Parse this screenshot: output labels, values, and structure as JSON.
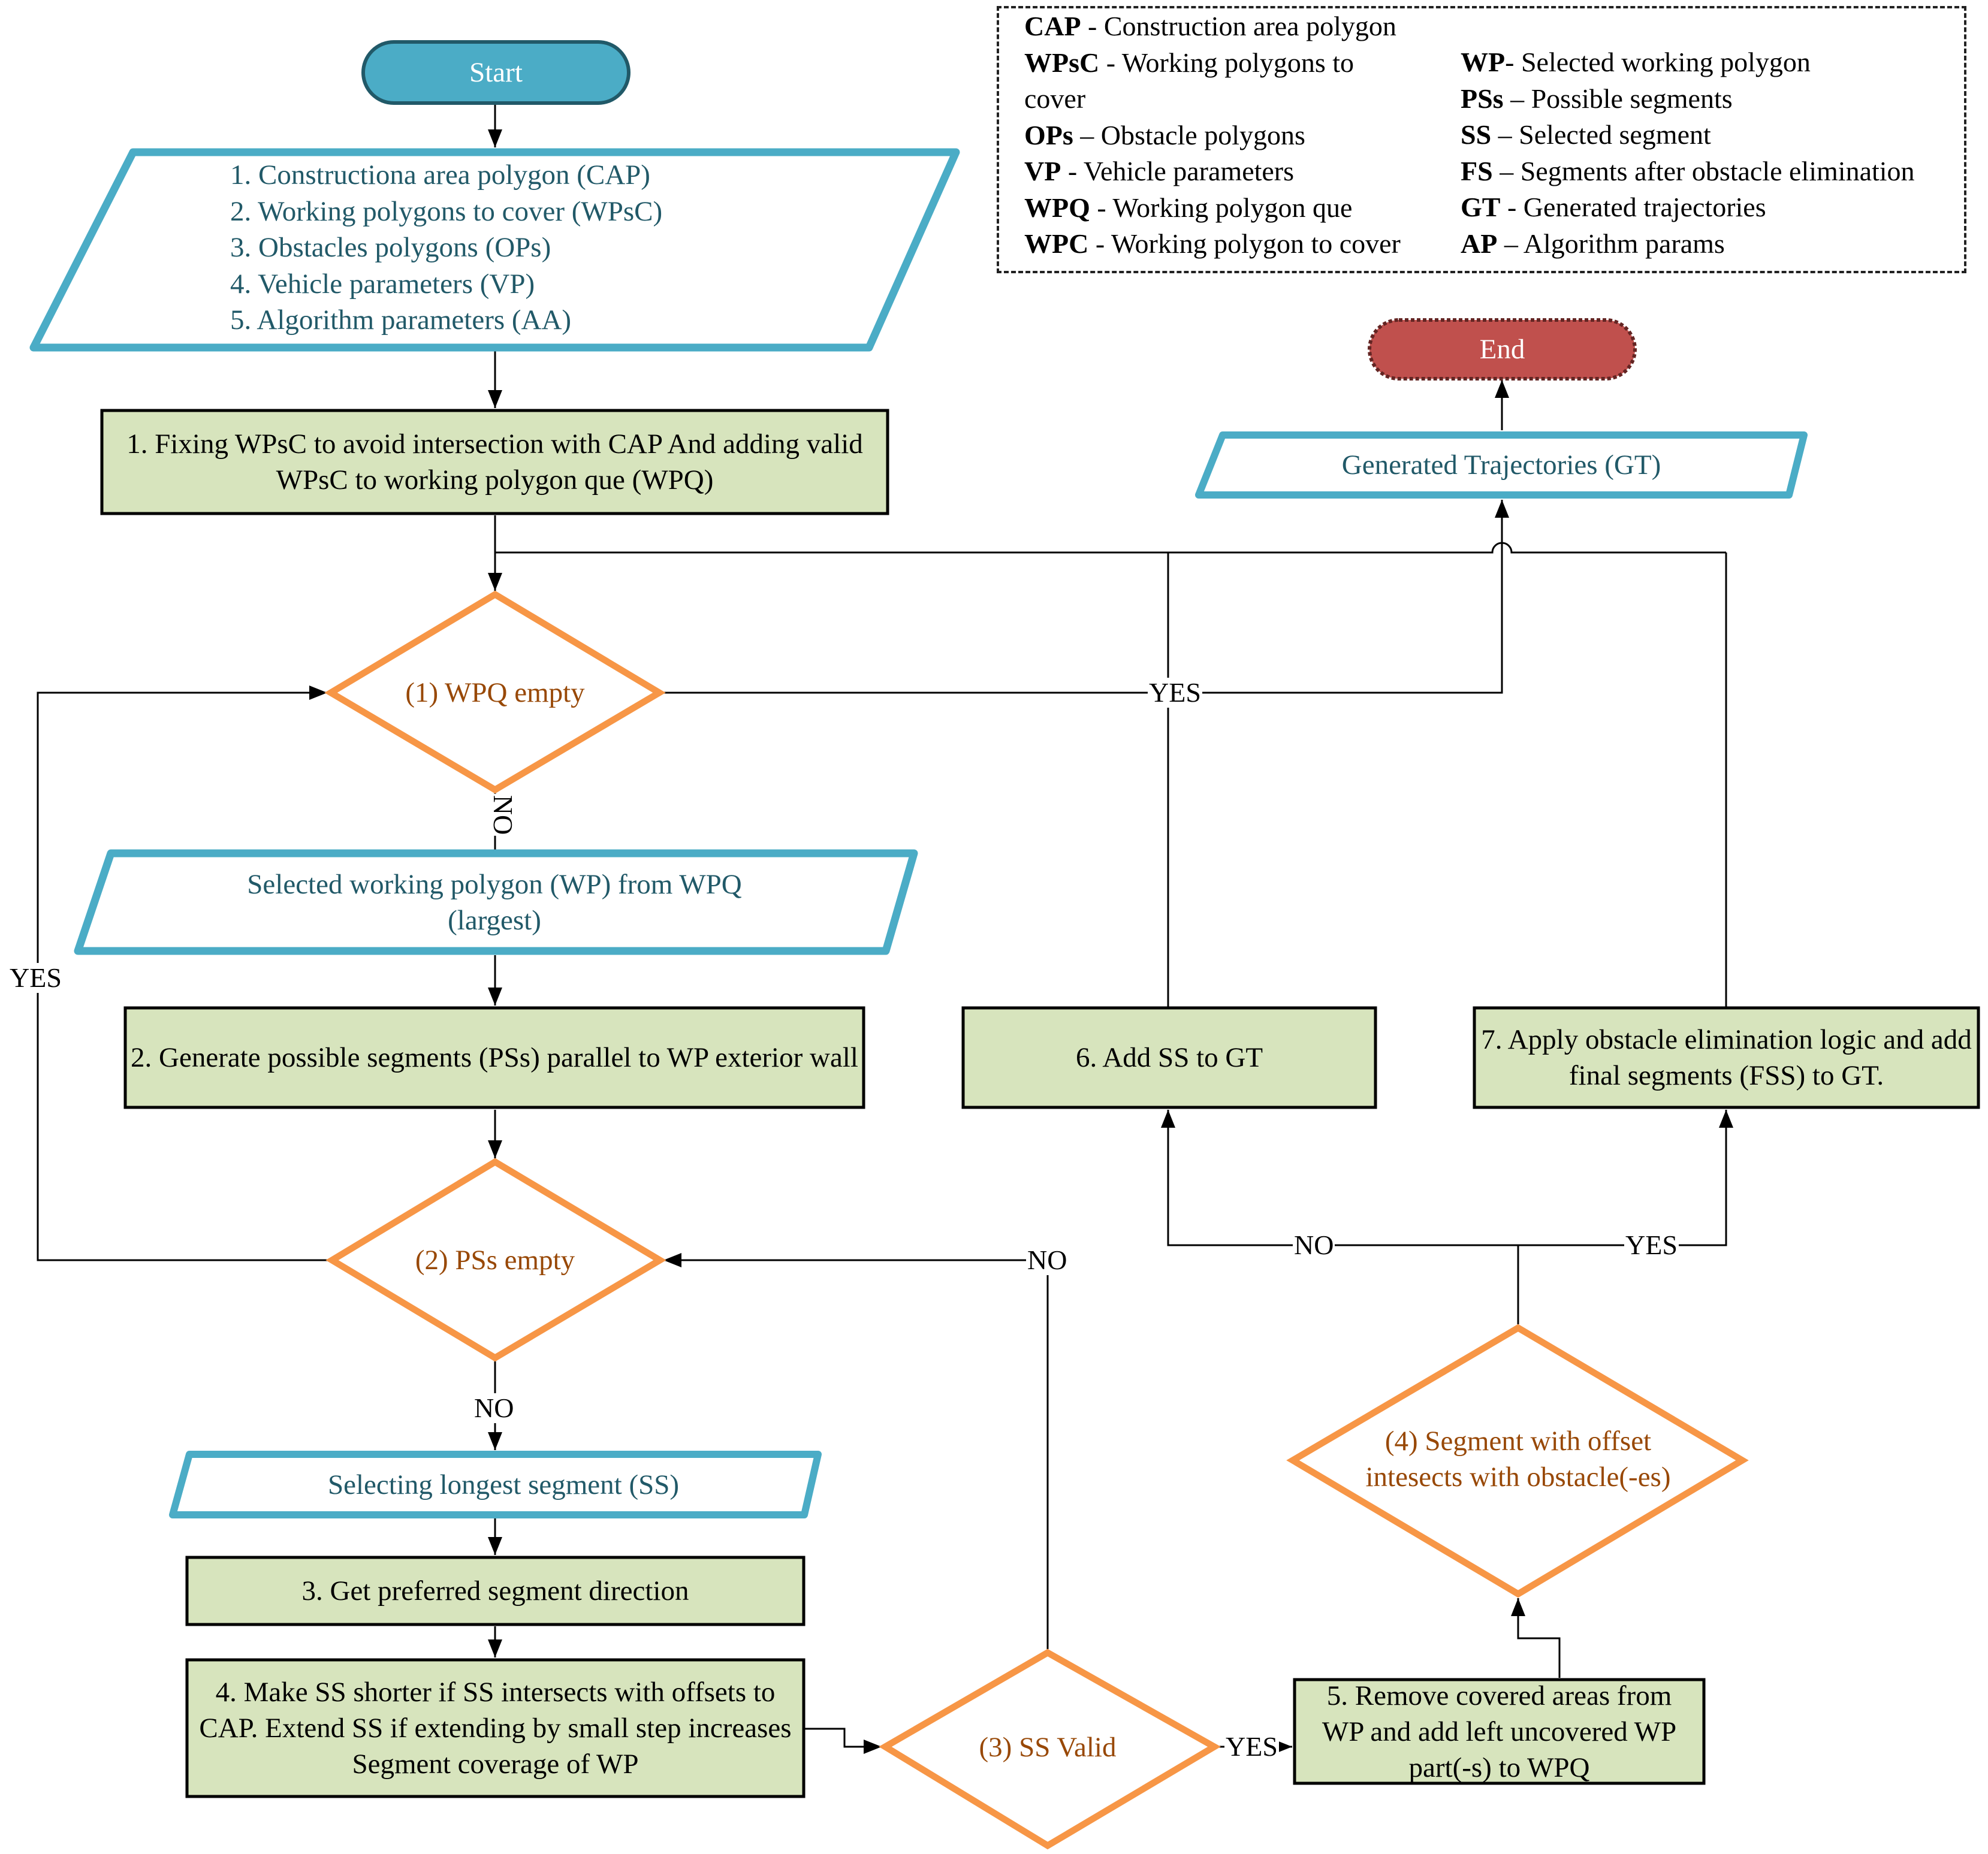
{
  "colors": {
    "start_fill": "#4bacc6",
    "start_stroke": "#215968",
    "end_fill": "#c0504d",
    "end_stroke": "#632523",
    "io_stroke": "#4bacc6",
    "io_text": "#215968",
    "process_fill": "#d7e4bd",
    "process_stroke": "#000000",
    "decision_stroke": "#f79646",
    "decision_text": "#984806"
  },
  "legend": {
    "left": [
      {
        "abbr": "CAP",
        "sep": " - ",
        "desc": "Construction area polygon"
      },
      {
        "abbr": "WPsC",
        "sep": " - ",
        "desc": "Working polygons to cover"
      },
      {
        "abbr": "OPs",
        "sep": " – ",
        "desc": "Obstacle polygons"
      },
      {
        "abbr": "VP",
        "sep": " - ",
        "desc": "Vehicle parameters"
      },
      {
        "abbr": "WPQ",
        "sep": " - ",
        "desc": "Working polygon que"
      },
      {
        "abbr": "WPC",
        "sep": " - ",
        "desc": "Working polygon to cover"
      }
    ],
    "right": [
      {
        "abbr": "WP",
        "sep": "- ",
        "desc": "Selected working polygon"
      },
      {
        "abbr": "PSs",
        "sep": " – ",
        "desc": "Possible segments"
      },
      {
        "abbr": "SS",
        "sep": " – ",
        "desc": "Selected segment"
      },
      {
        "abbr": "FS",
        "sep": " – ",
        "desc": "Segments after obstacle elimination"
      },
      {
        "abbr": "GT",
        "sep": " - ",
        "desc": "Generated trajectories"
      },
      {
        "abbr": "AP",
        "sep": " – ",
        "desc": "Algorithm params"
      }
    ]
  },
  "nodes": {
    "start": "Start",
    "end": "End",
    "inputs": [
      "1. Constructiona area polygon (CAP)",
      "2. Working polygons to cover (WPsC)",
      "3. Obstacles polygons (OPs)",
      "4. Vehicle parameters (VP)",
      "5. Algorithm parameters (AA)"
    ],
    "step1": "1. Fixing WPsC  to avoid intersection with CAP And adding valid WPsC to working polygon que (WPQ)",
    "decision1": "(1) WPQ empty",
    "select_wp": "Selected working polygon (WP) from WPQ (largest)",
    "step2": "2. Generate possible segments (PSs) parallel to WP exterior wall",
    "decision2": "(2) PSs empty",
    "select_ss": "Selecting longest segment (SS)",
    "step3": "3. Get preferred segment direction",
    "step4": "4. Make SS shorter if SS intersects with offsets to CAP. Extend SS if extending by small step increases Segment coverage of WP",
    "decision3": "(3) SS Valid",
    "step5": "5. Remove covered areas from WP and add left uncovered WP part(-s) to WPQ",
    "decision4": "(4) Segment with offset intesects with obstacle(-es)",
    "step6": "6. Add SS to GT",
    "step7": "7. Apply obstacle elimination logic and add final segments (FSS) to GT.",
    "generated": "Generated Trajectories (GT)"
  },
  "edge_labels": {
    "d1_yes": "YES",
    "d1_no": "NO",
    "d2_yes": "YES",
    "d2_no": "NO",
    "d3_no": "NO",
    "d3_yes": "YES",
    "d4_no": "NO",
    "d4_yes": "YES"
  }
}
